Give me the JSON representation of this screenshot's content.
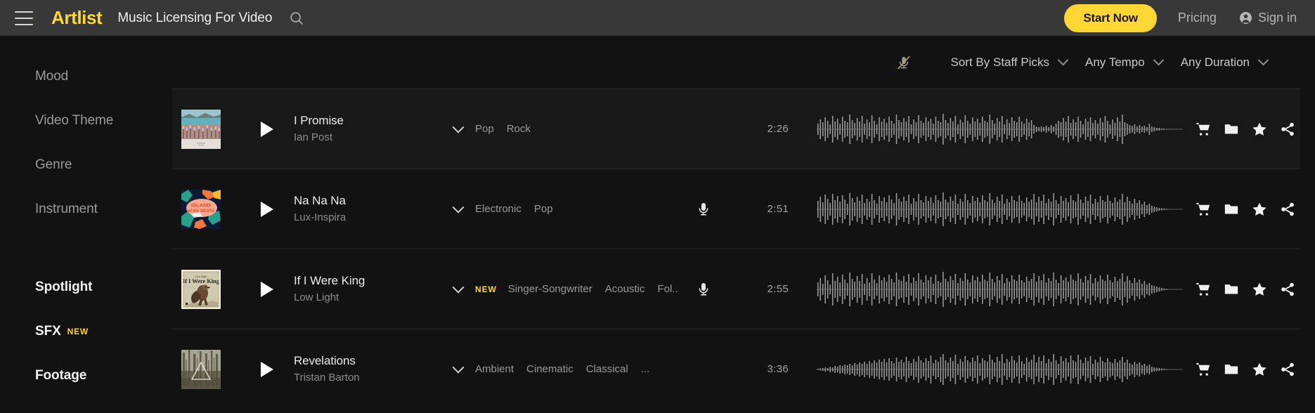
{
  "nav": {
    "menu_icon": "hamburger-icon",
    "brand": "Artlist",
    "tagline": "Music Licensing For Video",
    "search_icon": "search-icon",
    "start_now_label": "Start Now",
    "pricing_label": "Pricing",
    "signin_label": "Sign in",
    "signin_icon": "user-circle-icon",
    "accent_color": "#ffd633",
    "bar_color": "#383838"
  },
  "sidebar": {
    "items": [
      {
        "label": "Mood",
        "strong": false,
        "badge": ""
      },
      {
        "label": "Video Theme",
        "strong": false,
        "badge": ""
      },
      {
        "label": "Genre",
        "strong": false,
        "badge": ""
      },
      {
        "label": "Instrument",
        "strong": false,
        "badge": ""
      },
      {
        "label": "Spotlight",
        "strong": true,
        "badge": ""
      },
      {
        "label": "SFX",
        "strong": true,
        "badge": "NEW"
      },
      {
        "label": "Footage",
        "strong": true,
        "badge": ""
      }
    ]
  },
  "filterbar": {
    "mute_icon": "mic-muted-icon",
    "dropdowns": [
      {
        "label": "Sort By Staff Picks"
      },
      {
        "label": "Any Tempo"
      },
      {
        "label": "Any Duration"
      }
    ]
  },
  "tracks": [
    {
      "title": "I Promise",
      "artist": "Ian Post",
      "is_new": false,
      "new_label": "",
      "tags": [
        "Pop",
        "Rock"
      ],
      "overflow": "",
      "has_vocals": false,
      "duration": "2:26",
      "active": true,
      "artwork": "landscape-lake-lupines-photo"
    },
    {
      "title": "Na Na Na",
      "artist": "Lux-Inspira",
      "is_new": false,
      "new_label": "",
      "tags": [
        "Electronic",
        "Pop"
      ],
      "overflow": "",
      "has_vocals": true,
      "duration": "2:51",
      "active": false,
      "artwork": "island-of-the-beats-illustration"
    },
    {
      "title": "If I Were King",
      "artist": "Low Light",
      "is_new": true,
      "new_label": "NEW",
      "tags": [
        "Singer-Songwriter",
        "Acoustic",
        "Fol..."
      ],
      "overflow": "",
      "has_vocals": true,
      "duration": "2:55",
      "active": false,
      "artwork": "if-i-were-king-bird-illustration"
    },
    {
      "title": "Revelations",
      "artist": "Tristan Barton",
      "is_new": false,
      "new_label": "",
      "tags": [
        "Ambient",
        "Cinematic",
        "Classical"
      ],
      "overflow": "...",
      "has_vocals": false,
      "duration": "3:36",
      "active": false,
      "artwork": "misty-forest-triangle-photo"
    }
  ],
  "row_actions": [
    {
      "name": "cart-icon",
      "label": "Add to cart"
    },
    {
      "name": "folder-icon",
      "label": "Add to folder"
    },
    {
      "name": "star-icon",
      "label": "Add to favorites"
    },
    {
      "name": "share-icon",
      "label": "Share"
    }
  ]
}
